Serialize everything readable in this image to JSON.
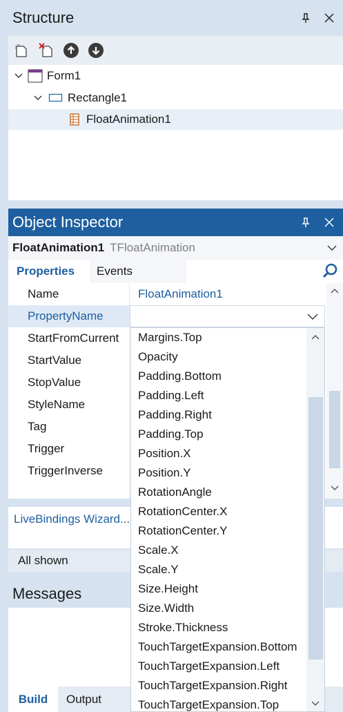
{
  "structure": {
    "title": "Structure",
    "tree": [
      {
        "label": "Form1"
      },
      {
        "label": "Rectangle1"
      },
      {
        "label": "FloatAnimation1"
      }
    ]
  },
  "object_inspector": {
    "title": "Object Inspector",
    "object_name": "FloatAnimation1",
    "object_type": "TFloatAnimation",
    "tabs": {
      "properties": "Properties",
      "events": "Events"
    },
    "properties": [
      {
        "name": "Name",
        "value": "FloatAnimation1"
      },
      {
        "name": "PropertyName",
        "value": ""
      },
      {
        "name": "StartFromCurrent",
        "value": ""
      },
      {
        "name": "StartValue",
        "value": ""
      },
      {
        "name": "StopValue",
        "value": ""
      },
      {
        "name": "StyleName",
        "value": ""
      },
      {
        "name": "Tag",
        "value": ""
      },
      {
        "name": "Trigger",
        "value": ""
      },
      {
        "name": "TriggerInverse",
        "value": ""
      }
    ],
    "livebindings_link": "LiveBindings Wizard...",
    "filter_status": "All shown"
  },
  "property_dropdown": {
    "items": [
      "Margins.Top",
      "Opacity",
      "Padding.Bottom",
      "Padding.Left",
      "Padding.Right",
      "Padding.Top",
      "Position.X",
      "Position.Y",
      "RotationAngle",
      "RotationCenter.X",
      "RotationCenter.Y",
      "Scale.X",
      "Scale.Y",
      "Size.Height",
      "Size.Width",
      "Stroke.Thickness",
      "TouchTargetExpansion.Bottom",
      "TouchTargetExpansion.Left",
      "TouchTargetExpansion.Right",
      "TouchTargetExpansion.Top"
    ]
  },
  "messages": {
    "title": "Messages",
    "tabs": {
      "build": "Build",
      "output": "Output"
    }
  },
  "colors": {
    "accent": "#1e5fa0",
    "panel_bg": "#d6e2ef",
    "selection": "#dfe9f5"
  }
}
